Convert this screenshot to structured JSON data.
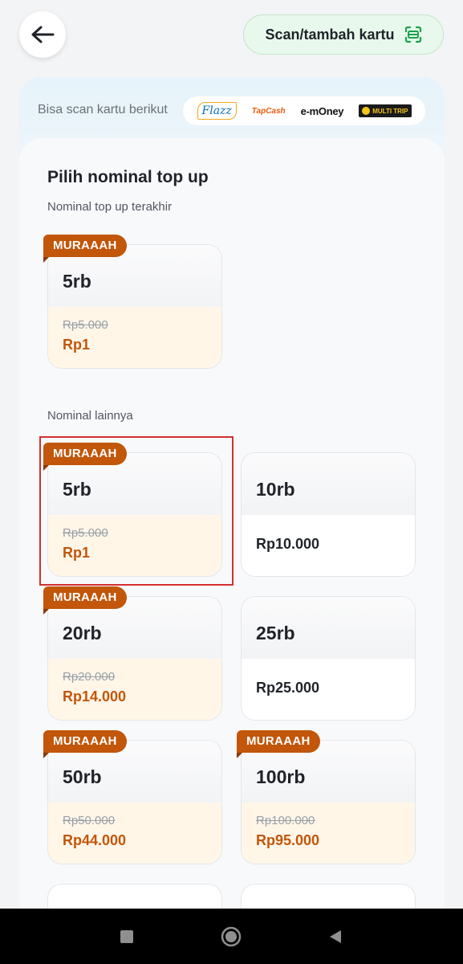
{
  "header": {
    "back_icon": "arrow-left-icon",
    "scan_button_label": "Scan/tambah kartu",
    "scan_icon": "card-scan-icon",
    "accent_color": "#16a34a"
  },
  "scan_info": {
    "label": "Bisa scan kartu berikut",
    "logos": {
      "flazz": "Flazz",
      "tapcash": "TapCash",
      "emoney": "e-mOney",
      "multitrip": "MULTI TRIP"
    }
  },
  "topup": {
    "title": "Pilih nominal top up",
    "recent_label": "Nominal top up terakhir",
    "other_label": "Nominal lainnya",
    "promo_badge": "MURAAAH",
    "promo_color": "#c2560a",
    "recent": [
      {
        "amount": "5rb",
        "original": "Rp5.000",
        "price": "Rp1"
      }
    ],
    "others": [
      {
        "amount": "5rb",
        "original": "Rp5.000",
        "price": "Rp1",
        "promo": true
      },
      {
        "amount": "10rb",
        "price": "Rp10.000",
        "promo": false
      },
      {
        "amount": "20rb",
        "original": "Rp20.000",
        "price": "Rp14.000",
        "promo": true
      },
      {
        "amount": "25rb",
        "price": "Rp25.000",
        "promo": false
      },
      {
        "amount": "50rb",
        "original": "Rp50.000",
        "price": "Rp44.000",
        "promo": true
      },
      {
        "amount": "100rb",
        "original": "Rp100.000",
        "price": "Rp95.000",
        "promo": true
      }
    ]
  },
  "system_nav": {
    "recents_icon": "square-icon",
    "home_icon": "circle-icon",
    "back_icon": "triangle-back-icon"
  }
}
